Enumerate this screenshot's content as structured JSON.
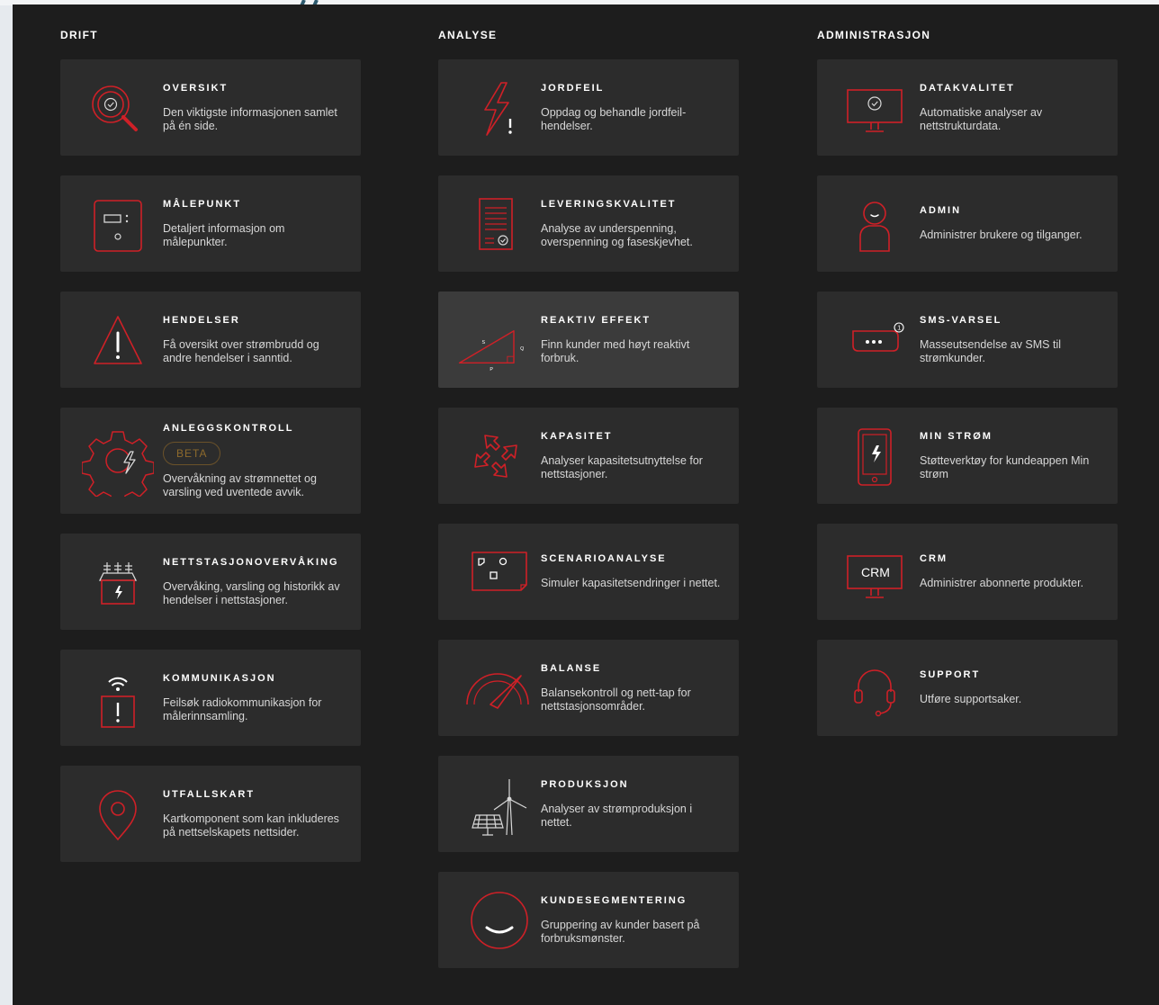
{
  "colors": {
    "panel": "#1d1d1d",
    "card": "#2c2c2c",
    "card_active": "#3b3b3b",
    "accent": "#cf2027",
    "beta": "#8d6a2c"
  },
  "columns": [
    {
      "heading": "DRIFT",
      "cards": [
        {
          "icon": "search-check-icon",
          "title": "OVERSIKT",
          "desc": "Den viktigste informasjonen samlet på én side."
        },
        {
          "icon": "meter-icon",
          "title": "MÅLEPUNKT",
          "desc": "Detaljert informasjon om målepunkter."
        },
        {
          "icon": "warning-icon",
          "title": "HENDELSER",
          "desc": "Få oversikt over strømbrudd og andre hendelser i sanntid."
        },
        {
          "icon": "gear-bolt-icon",
          "title": "ANLEGGSKONTROLL",
          "badge": "BETA",
          "desc": "Overvåkning av strømnettet og varsling ved uventede avvik."
        },
        {
          "icon": "substation-icon",
          "title": "NETTSTASJONOVERVÅKING",
          "desc": "Overvåking, varsling og historikk av hendelser i nettstasjoner."
        },
        {
          "icon": "radio-alert-icon",
          "title": "KOMMUNIKASJON",
          "desc": "Feilsøk radiokommunikasjon for målerinnsamling."
        },
        {
          "icon": "map-pin-icon",
          "title": "UTFALLSKART",
          "desc": "Kartkomponent som kan inkluderes på nettselskapets nettsider."
        }
      ]
    },
    {
      "heading": "ANALYSE",
      "cards": [
        {
          "icon": "ground-fault-icon",
          "title": "JORDFEIL",
          "desc": "Oppdag og behandle jordfeil-hendelser."
        },
        {
          "icon": "document-check-icon",
          "title": "LEVERINGSKVALITET",
          "desc": "Analyse av underspenning, overspenning og faseskjevhet."
        },
        {
          "icon": "power-triangle-icon",
          "title": "REAKTIV EFFEKT",
          "desc": "Finn kunder med høyt reaktivt forbruk.",
          "labels": {
            "s": "S",
            "q": "Q",
            "p": "P"
          }
        },
        {
          "icon": "expand-arrows-icon",
          "title": "KAPASITET",
          "desc": "Analyser kapasitetsutnyttelse for nettstasjoner."
        },
        {
          "icon": "scenario-sheet-icon",
          "title": "SCENARIOANALYSE",
          "desc": "Simuler kapasitetsendringer i nettet."
        },
        {
          "icon": "gauge-icon",
          "title": "BALANSE",
          "desc": "Balansekontroll og nett-tap for nettstasjonsområder."
        },
        {
          "icon": "wind-solar-icon",
          "title": "PRODUKSJON",
          "desc": "Analyser av strømproduksjon i nettet."
        },
        {
          "icon": "smile-circle-icon",
          "title": "KUNDESEGMENTERING",
          "desc": "Gruppering av kunder basert på forbruksmønster."
        }
      ]
    },
    {
      "heading": "ADMINISTRASJON",
      "cards": [
        {
          "icon": "monitor-check-icon",
          "title": "DATAKVALITET",
          "desc": "Automatiske analyser av nettstrukturdata."
        },
        {
          "icon": "user-icon",
          "title": "ADMIN",
          "desc": "Administrer brukere og tilganger."
        },
        {
          "icon": "sms-bubble-icon",
          "title": "SMS-VARSEL",
          "desc": "Masseutsendelse av SMS til strømkunder.",
          "badge_count": "1"
        },
        {
          "icon": "phone-bolt-icon",
          "title": "MIN STRØM",
          "desc": "Støtteverktøy for kundeappen Min strøm"
        },
        {
          "icon": "crm-monitor-icon",
          "title": "CRM",
          "desc": "Administrer abonnerte produkter.",
          "screen_text": "CRM"
        },
        {
          "icon": "headset-icon",
          "title": "SUPPORT",
          "desc": "Utføre supportsaker."
        }
      ]
    }
  ]
}
